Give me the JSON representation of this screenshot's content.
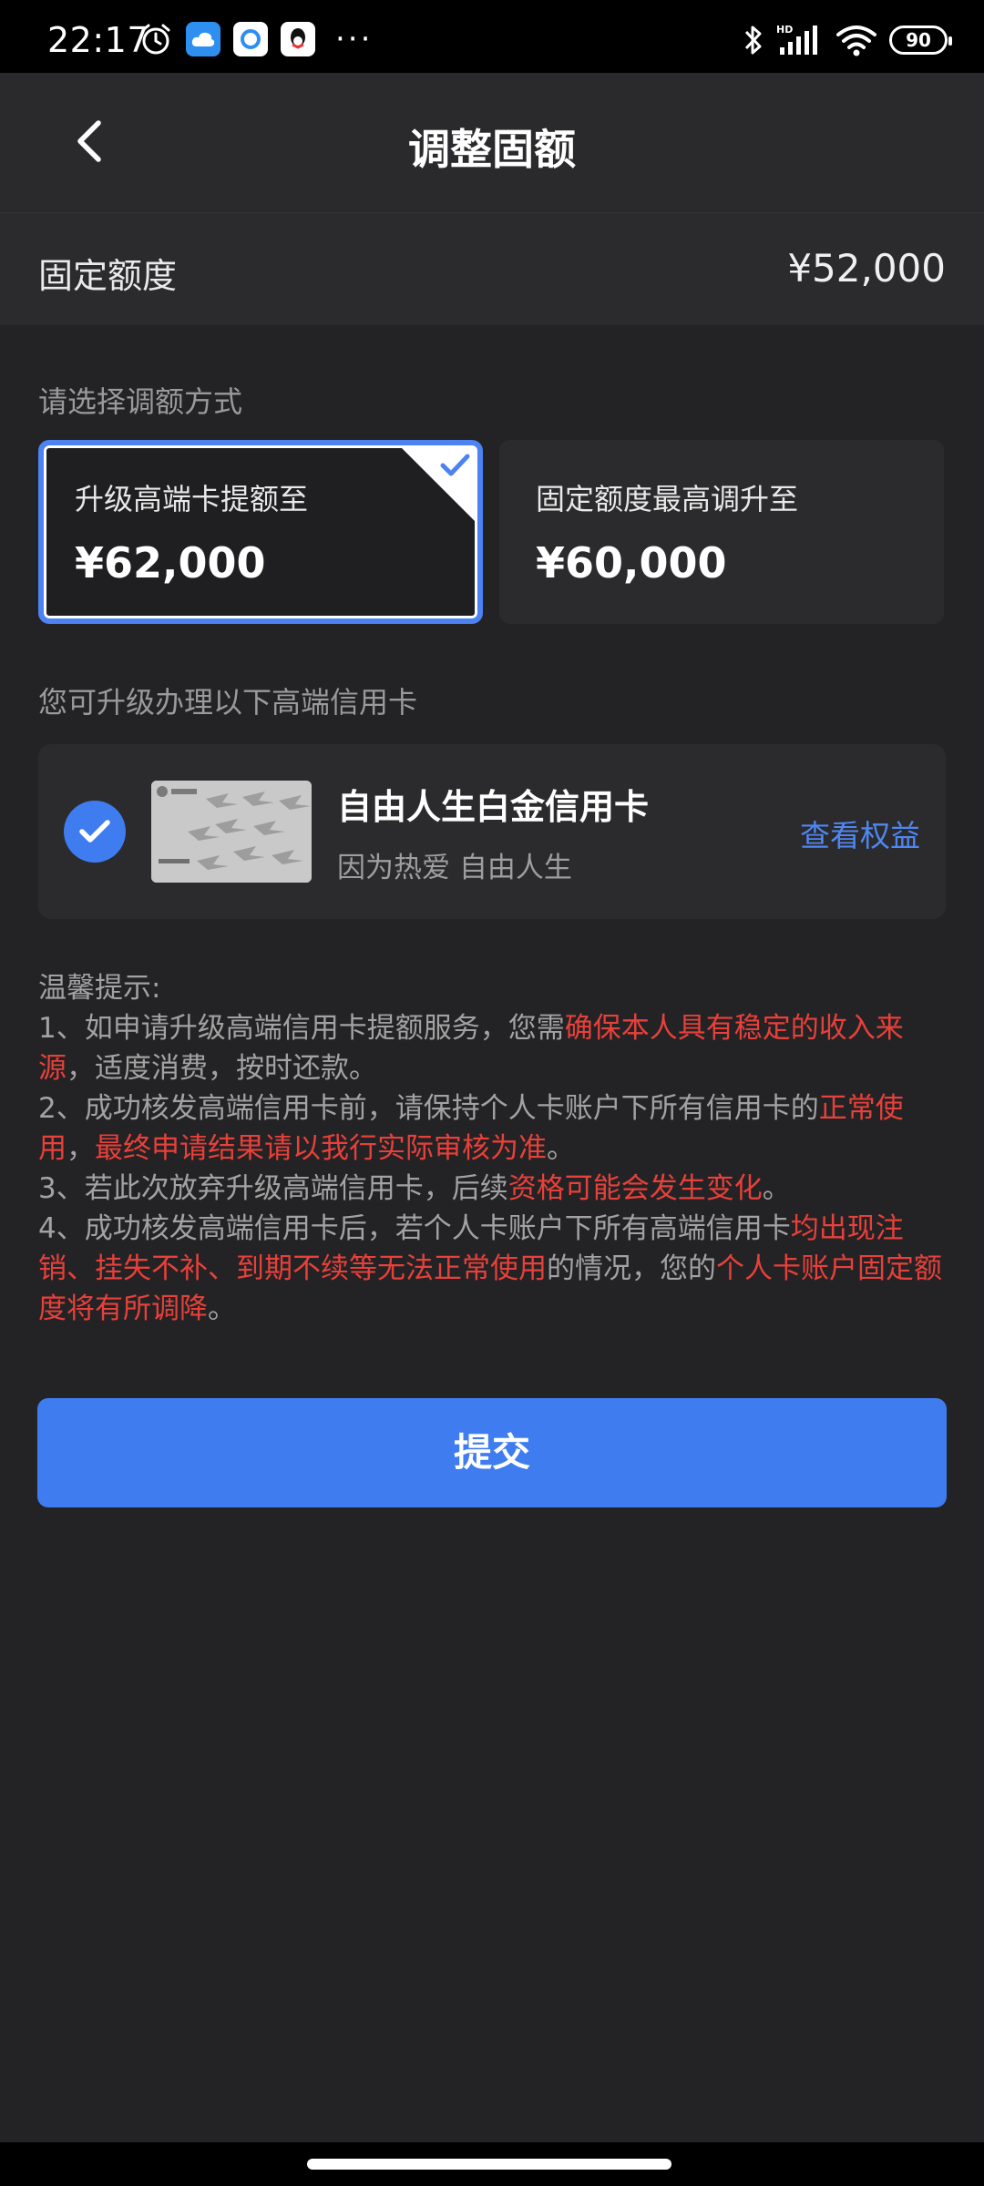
{
  "status_bar": {
    "time": "22:17",
    "battery": "90",
    "icons": [
      "alarm-icon",
      "cloud-app-icon",
      "browser-app-icon",
      "qq-app-icon",
      "more-dots",
      "bluetooth-icon",
      "hd-signal-icon",
      "wifi-icon",
      "battery-icon"
    ]
  },
  "nav": {
    "title": "调整固额"
  },
  "fixed_amount": {
    "label": "固定额度",
    "value": "¥52,000"
  },
  "method": {
    "section_label": "请选择调额方式",
    "options": [
      {
        "label": "升级高端卡提额至",
        "amount": "¥62,000",
        "selected": true
      },
      {
        "label": "固定额度最高调升至",
        "amount": "¥60,000",
        "selected": false
      }
    ]
  },
  "upgrade": {
    "section_label": "您可升级办理以下高端信用卡",
    "card_name": "自由人生白金信用卡",
    "card_slogan": "因为热爱 自由人生",
    "link_label": "查看权益"
  },
  "tips": {
    "title": "温馨提示:",
    "t1a": "1、如申请升级高端信用卡提额服务，您需",
    "t1b": "确保本人具有稳定的收入来源",
    "t1c": "，适度消费，按时还款。",
    "t2a": "2、成功核发高端信用卡前，请保持个人卡账户下所有信用卡的",
    "t2b": "正常使用",
    "t2c": "，",
    "t2d": "最终申请结果请以我行实际审核为准",
    "t2e": "。",
    "t3a": "3、若此次放弃升级高端信用卡，后续",
    "t3b": "资格可能会发生变化",
    "t3c": "。",
    "t4a": "4、成功核发高端信用卡后，若个人卡账户下所有高端信用卡",
    "t4b": "均出现注销、挂失不补、到期不续等无法正常使用",
    "t4c": "的情况，您的",
    "t4d": "个人卡账户固定额度将有所调降",
    "t4e": "。"
  },
  "submit_label": "提交",
  "colors": {
    "accent": "#3f7cf0",
    "warning": "#e8403a",
    "background": "#232325"
  }
}
